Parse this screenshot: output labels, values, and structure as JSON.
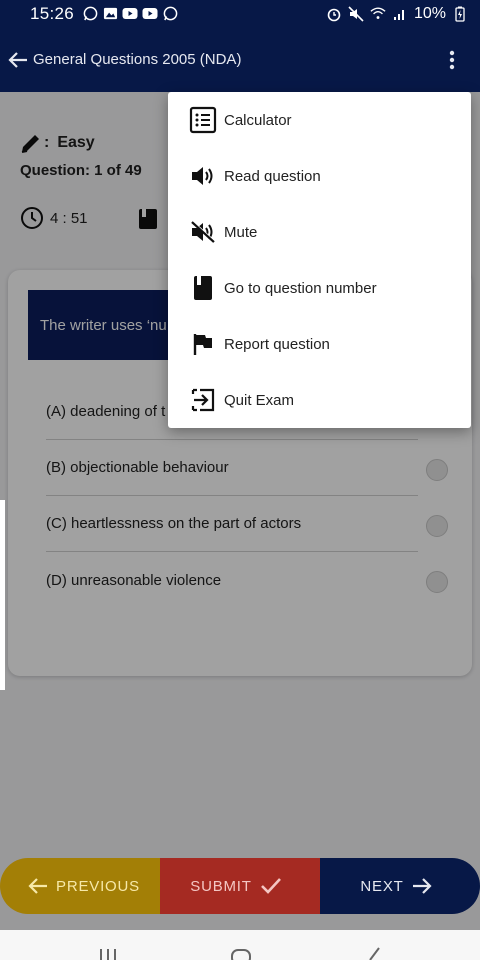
{
  "status_bar": {
    "time": "15:26",
    "battery": "10%"
  },
  "app_bar": {
    "title": "General Questions 2005 (NDA)"
  },
  "question_meta": {
    "difficulty_label": "Easy",
    "question_counter": "Question: 1 of 49",
    "timer": "4 : 51"
  },
  "question": {
    "text": "The writer uses ‘nu"
  },
  "options": [
    {
      "label": "(A) deadening of t"
    },
    {
      "label": "(B) objectionable behaviour"
    },
    {
      "label": "(C) heartlessness on the part of actors"
    },
    {
      "label": "(D) unreasonable violence"
    }
  ],
  "menu": {
    "items": [
      {
        "label": "Calculator",
        "icon": "list-icon"
      },
      {
        "label": "Read question",
        "icon": "speaker-icon"
      },
      {
        "label": "Mute",
        "icon": "mute-icon"
      },
      {
        "label": "Go to question number",
        "icon": "book-icon"
      },
      {
        "label": "Report question",
        "icon": "flag-icon"
      },
      {
        "label": "Quit Exam",
        "icon": "exit-icon"
      }
    ]
  },
  "bottom_bar": {
    "previous_label": "PREVIOUS",
    "submit_label": "SUBMIT",
    "next_label": "NEXT"
  },
  "colors": {
    "primary_navy": "#071847",
    "previous_yellow": "#a37f06",
    "submit_red": "#a52a22"
  }
}
